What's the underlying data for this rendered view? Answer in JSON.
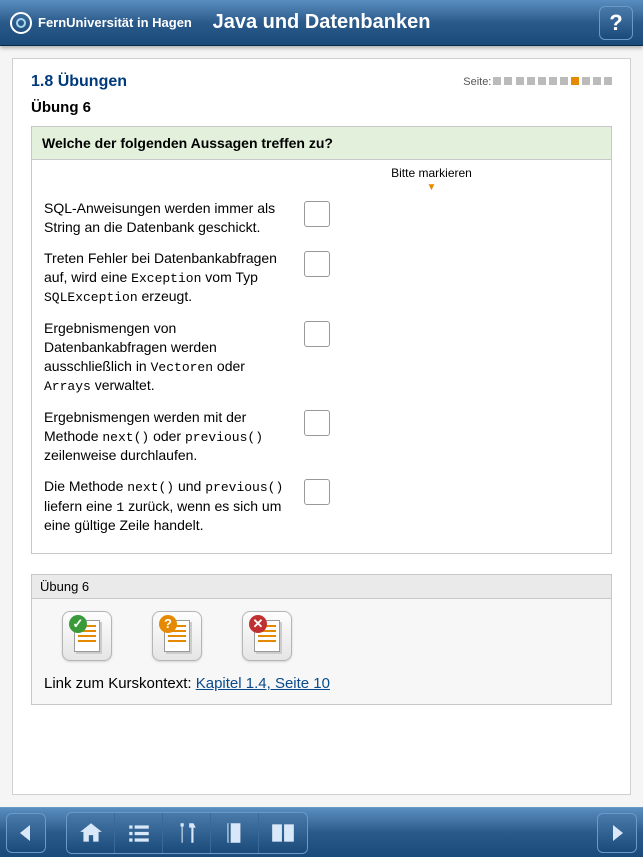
{
  "header": {
    "org": "FernUniversität in Hagen",
    "title": "Java und Datenbanken",
    "help": "?"
  },
  "section": {
    "number_title": "1.8 Übungen",
    "page_label": "Seite:",
    "pages_total": 11,
    "page_active_index": 7,
    "subheading": "Übung 6"
  },
  "question": {
    "prompt": "Welche der folgenden Aussagen treffen zu?",
    "mark_hint": "Bitte markieren",
    "items": [
      {
        "pre": "SQL-Anweisungen werden immer als String an die Datenbank geschickt."
      },
      {
        "pre": "Treten Fehler bei Datenbankabfragen auf, wird eine ",
        "c1": "Exception",
        "mid1": " vom Typ ",
        "c2": "SQLException",
        "post": " erzeugt."
      },
      {
        "pre": "Ergebnismengen von Datenbankabfragen werden ausschließlich in ",
        "c1": "Vectoren",
        "mid1": " oder ",
        "c2": "Arrays",
        "post": " verwaltet."
      },
      {
        "pre": "Ergebnismengen werden mit der Methode ",
        "c1": "next()",
        "mid1": " oder ",
        "c2": "previous()",
        "post": " zeilenweise durchlaufen."
      },
      {
        "pre": "Die Methode ",
        "c1": "next()",
        "mid1": " und ",
        "c2": "previous()",
        "mid2": " liefern eine ",
        "c3": "1",
        "post": " zurück, wenn es sich um eine gültige Zeile handelt."
      }
    ]
  },
  "footer_panel": {
    "title": "Übung 6",
    "context_label": "Link zum Kurskontext: ",
    "context_link": "Kapitel 1.4, Seite 10",
    "actions": [
      "check",
      "hint",
      "reset"
    ]
  },
  "bottom": {
    "prev": "◀",
    "next": "▶"
  }
}
